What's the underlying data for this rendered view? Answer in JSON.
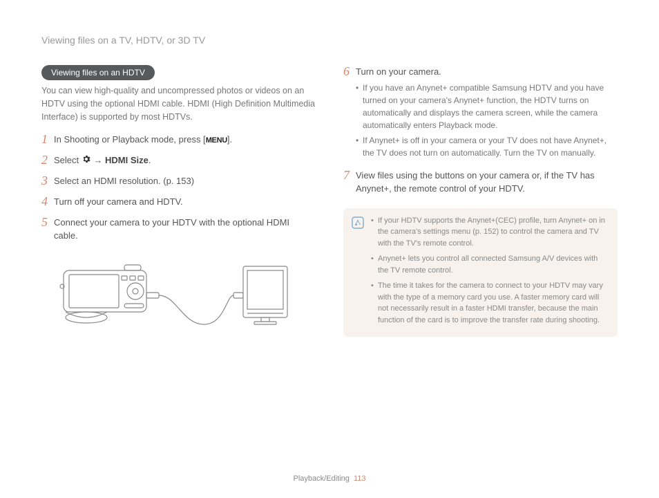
{
  "header": {
    "title": "Viewing files on a TV, HDTV, or 3D TV"
  },
  "section": {
    "pill": "Viewing files on an HDTV",
    "intro": "You can view high-quality and uncompressed photos or videos on an HDTV using the optional HDMI cable. HDMI (High Definition Multimedia Interface) is supported by most HDTVs."
  },
  "steps_left": {
    "s1_a": "In Shooting or Playback mode, press [",
    "s1_b": "].",
    "menu_label": "MENU",
    "s2_a": "Select ",
    "s2_b": " → ",
    "s2_c": "HDMI Size",
    "s2_d": ".",
    "s3": "Select an HDMI resolution. (p. 153)",
    "s4": "Turn off your camera and HDTV.",
    "s5": "Connect your camera to your HDTV with the optional HDMI cable."
  },
  "steps_right": {
    "s6": "Turn on your camera.",
    "s6_bullets": [
      "If you have an Anynet+ compatible Samsung HDTV and you have turned on your camera's Anynet+ function, the HDTV turns on automatically and displays the camera screen, while the camera automatically enters Playback mode.",
      "If Anynet+ is off in your camera or your TV does not have Anynet+, the TV does not turn on automatically. Turn the TV on manually."
    ],
    "s7": "View files using the buttons on your camera or, if the TV has Anynet+, the remote control of your HDTV."
  },
  "notes": [
    "If your HDTV supports the Anynet+(CEC) profile, turn Anynet+ on in the camera's settings menu (p. 152) to control the camera and TV with the TV's remote control.",
    "Anynet+ lets you control all connected Samsung A/V devices with the TV remote control.",
    "The time it takes for the camera to connect to your HDTV may vary with the type of a memory card you use. A faster memory card will not necessarily result in a faster HDMI transfer, because the main function of the card is to improve the transfer rate during shooting."
  ],
  "footer": {
    "section": "Playback/Editing",
    "page": "113"
  },
  "icons": {
    "gear": "gear-icon",
    "note": "note-icon"
  }
}
